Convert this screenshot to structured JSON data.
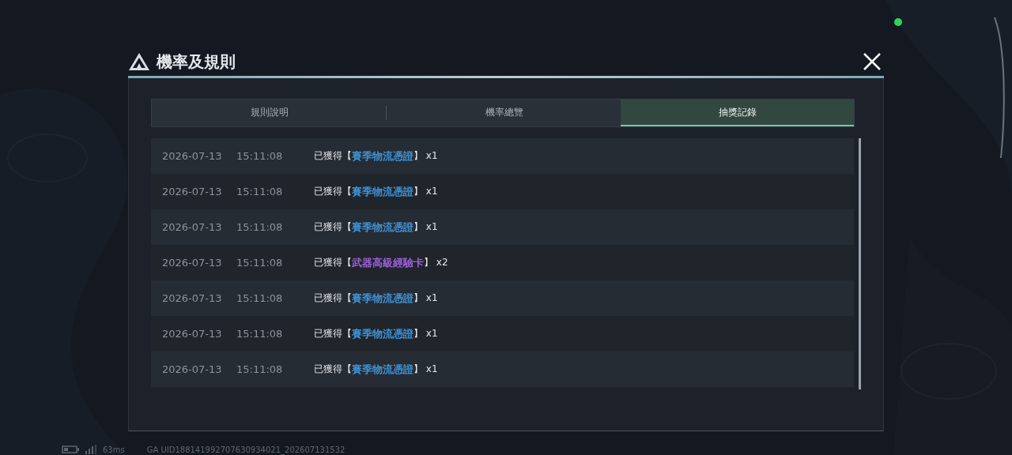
{
  "dialog": {
    "title": "機率及規則"
  },
  "tabs": [
    {
      "label": "規則說明",
      "selected": false
    },
    {
      "label": "機率總覽",
      "selected": false
    },
    {
      "label": "抽獎記錄",
      "selected": true
    }
  ],
  "records": [
    {
      "date": "2026-07-13",
      "time": "15:11:08",
      "prefix": "已獲得",
      "open": "【",
      "item": "賽季物流憑證",
      "close": "】",
      "qty": "x1",
      "color": "#3f8fd0"
    },
    {
      "date": "2026-07-13",
      "time": "15:11:08",
      "prefix": "已獲得",
      "open": "【",
      "item": "賽季物流憑證",
      "close": "】",
      "qty": "x1",
      "color": "#3f8fd0"
    },
    {
      "date": "2026-07-13",
      "time": "15:11:08",
      "prefix": "已獲得",
      "open": "【",
      "item": "賽季物流憑證",
      "close": "】",
      "qty": "x1",
      "color": "#3f8fd0"
    },
    {
      "date": "2026-07-13",
      "time": "15:11:08",
      "prefix": "已獲得",
      "open": "【",
      "item": "武器高級經驗卡",
      "close": "】",
      "qty": "x2",
      "color": "#9b5fd6"
    },
    {
      "date": "2026-07-13",
      "time": "15:11:08",
      "prefix": "已獲得",
      "open": "【",
      "item": "賽季物流憑證",
      "close": "】",
      "qty": "x1",
      "color": "#3f8fd0"
    },
    {
      "date": "2026-07-13",
      "time": "15:11:08",
      "prefix": "已獲得",
      "open": "【",
      "item": "賽季物流憑證",
      "close": "】",
      "qty": "x1",
      "color": "#3f8fd0"
    },
    {
      "date": "2026-07-13",
      "time": "15:11:08",
      "prefix": "已獲得",
      "open": "【",
      "item": "賽季物流憑證",
      "close": "】",
      "qty": "x1",
      "color": "#3f8fd0"
    }
  ],
  "status_bar": {
    "ping": "63ms",
    "uid": "GA UID188141992707630934021_202607131532"
  }
}
